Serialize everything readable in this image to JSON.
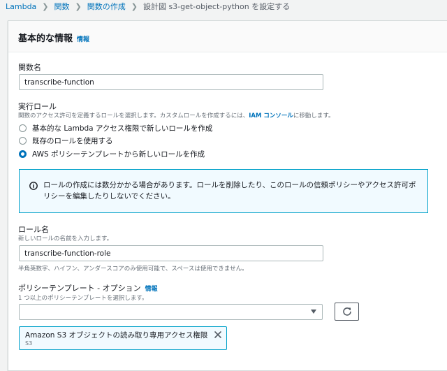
{
  "breadcrumb": {
    "items": [
      "Lambda",
      "関数",
      "関数の作成"
    ],
    "current": "設計図 s3-get-object-python を設定する"
  },
  "panel": {
    "title": "基本的な情報",
    "info": "情報"
  },
  "function_name": {
    "label": "関数名",
    "value": "transcribe-function"
  },
  "execution_role": {
    "label": "実行ロール",
    "description_prefix": "関数のアクセス許可を定義するロールを選択します。カスタムロールを作成するには、",
    "description_link": "IAM コンソール",
    "description_suffix": "に移動します。",
    "options": [
      {
        "label": "基本的な Lambda アクセス権限で新しいロールを作成",
        "checked": false
      },
      {
        "label": "既存のロールを使用する",
        "checked": false
      },
      {
        "label": "AWS ポリシーテンプレートから新しいロールを作成",
        "checked": true
      }
    ]
  },
  "alert": {
    "text": "ロールの作成には数分かかる場合があります。ロールを削除したり、このロールの信頼ポリシーやアクセス許可ポリシーを編集したりしないでください。",
    "icon": "info-icon"
  },
  "role_name": {
    "label": "ロール名",
    "description": "新しいロールの名前を入力します。",
    "value": "transcribe-function-role",
    "constraint": "半角英数字、ハイフン、アンダースコアのみ使用可能で、スペースは使用できません。"
  },
  "policy_templates": {
    "label": "ポリシーテンプレート - オプション",
    "info": "情報",
    "description": "1 つ以上のポリシーテンプレートを選択します。",
    "selected_value": "",
    "token": {
      "title": "Amazon S3 オブジェクトの読み取り専用アクセス権限",
      "subtitle": "S3"
    }
  },
  "colors": {
    "link": "#0073bb",
    "alert_border": "#00a1c9",
    "alert_bg": "#f1faff",
    "page_bg": "#f2f3f3"
  }
}
